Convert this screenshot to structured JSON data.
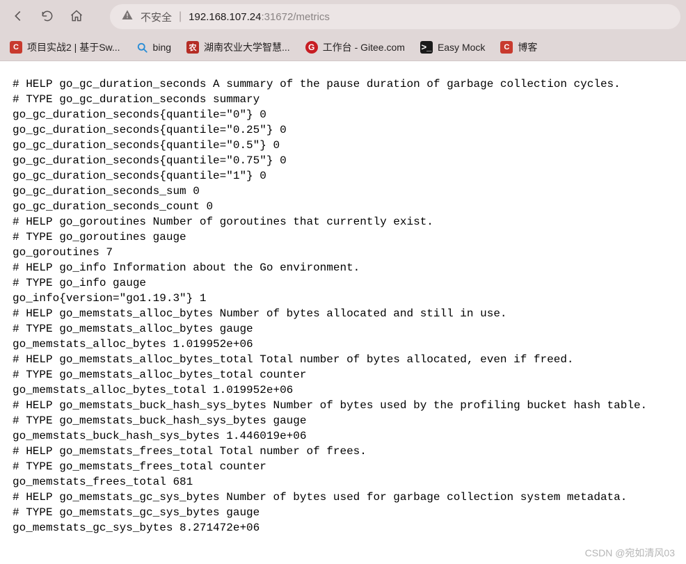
{
  "toolbar": {
    "back_label": "Back",
    "reload_label": "Reload",
    "home_label": "Home"
  },
  "address_bar": {
    "insecure_label": "不安全",
    "url_host": "192.168.107.24",
    "url_port_path": ":31672/metrics"
  },
  "bookmarks": [
    {
      "icon": "c",
      "label": "项目实战2 | 基于Sw..."
    },
    {
      "icon": "bing",
      "label": "bing"
    },
    {
      "icon": "hn",
      "label": "湖南农业大学智慧..."
    },
    {
      "icon": "git",
      "label": "工作台 - Gitee.com"
    },
    {
      "icon": "em",
      "label": "Easy Mock"
    },
    {
      "icon": "c",
      "label": "博客"
    }
  ],
  "metrics_lines": [
    "# HELP go_gc_duration_seconds A summary of the pause duration of garbage collection cycles.",
    "# TYPE go_gc_duration_seconds summary",
    "go_gc_duration_seconds{quantile=\"0\"} 0",
    "go_gc_duration_seconds{quantile=\"0.25\"} 0",
    "go_gc_duration_seconds{quantile=\"0.5\"} 0",
    "go_gc_duration_seconds{quantile=\"0.75\"} 0",
    "go_gc_duration_seconds{quantile=\"1\"} 0",
    "go_gc_duration_seconds_sum 0",
    "go_gc_duration_seconds_count 0",
    "# HELP go_goroutines Number of goroutines that currently exist.",
    "# TYPE go_goroutines gauge",
    "go_goroutines 7",
    "# HELP go_info Information about the Go environment.",
    "# TYPE go_info gauge",
    "go_info{version=\"go1.19.3\"} 1",
    "# HELP go_memstats_alloc_bytes Number of bytes allocated and still in use.",
    "# TYPE go_memstats_alloc_bytes gauge",
    "go_memstats_alloc_bytes 1.019952e+06",
    "# HELP go_memstats_alloc_bytes_total Total number of bytes allocated, even if freed.",
    "# TYPE go_memstats_alloc_bytes_total counter",
    "go_memstats_alloc_bytes_total 1.019952e+06",
    "# HELP go_memstats_buck_hash_sys_bytes Number of bytes used by the profiling bucket hash table.",
    "# TYPE go_memstats_buck_hash_sys_bytes gauge",
    "go_memstats_buck_hash_sys_bytes 1.446019e+06",
    "# HELP go_memstats_frees_total Total number of frees.",
    "# TYPE go_memstats_frees_total counter",
    "go_memstats_frees_total 681",
    "# HELP go_memstats_gc_sys_bytes Number of bytes used for garbage collection system metadata.",
    "# TYPE go_memstats_gc_sys_bytes gauge",
    "go_memstats_gc_sys_bytes 8.271472e+06"
  ],
  "watermark": "CSDN @宛如清风03"
}
